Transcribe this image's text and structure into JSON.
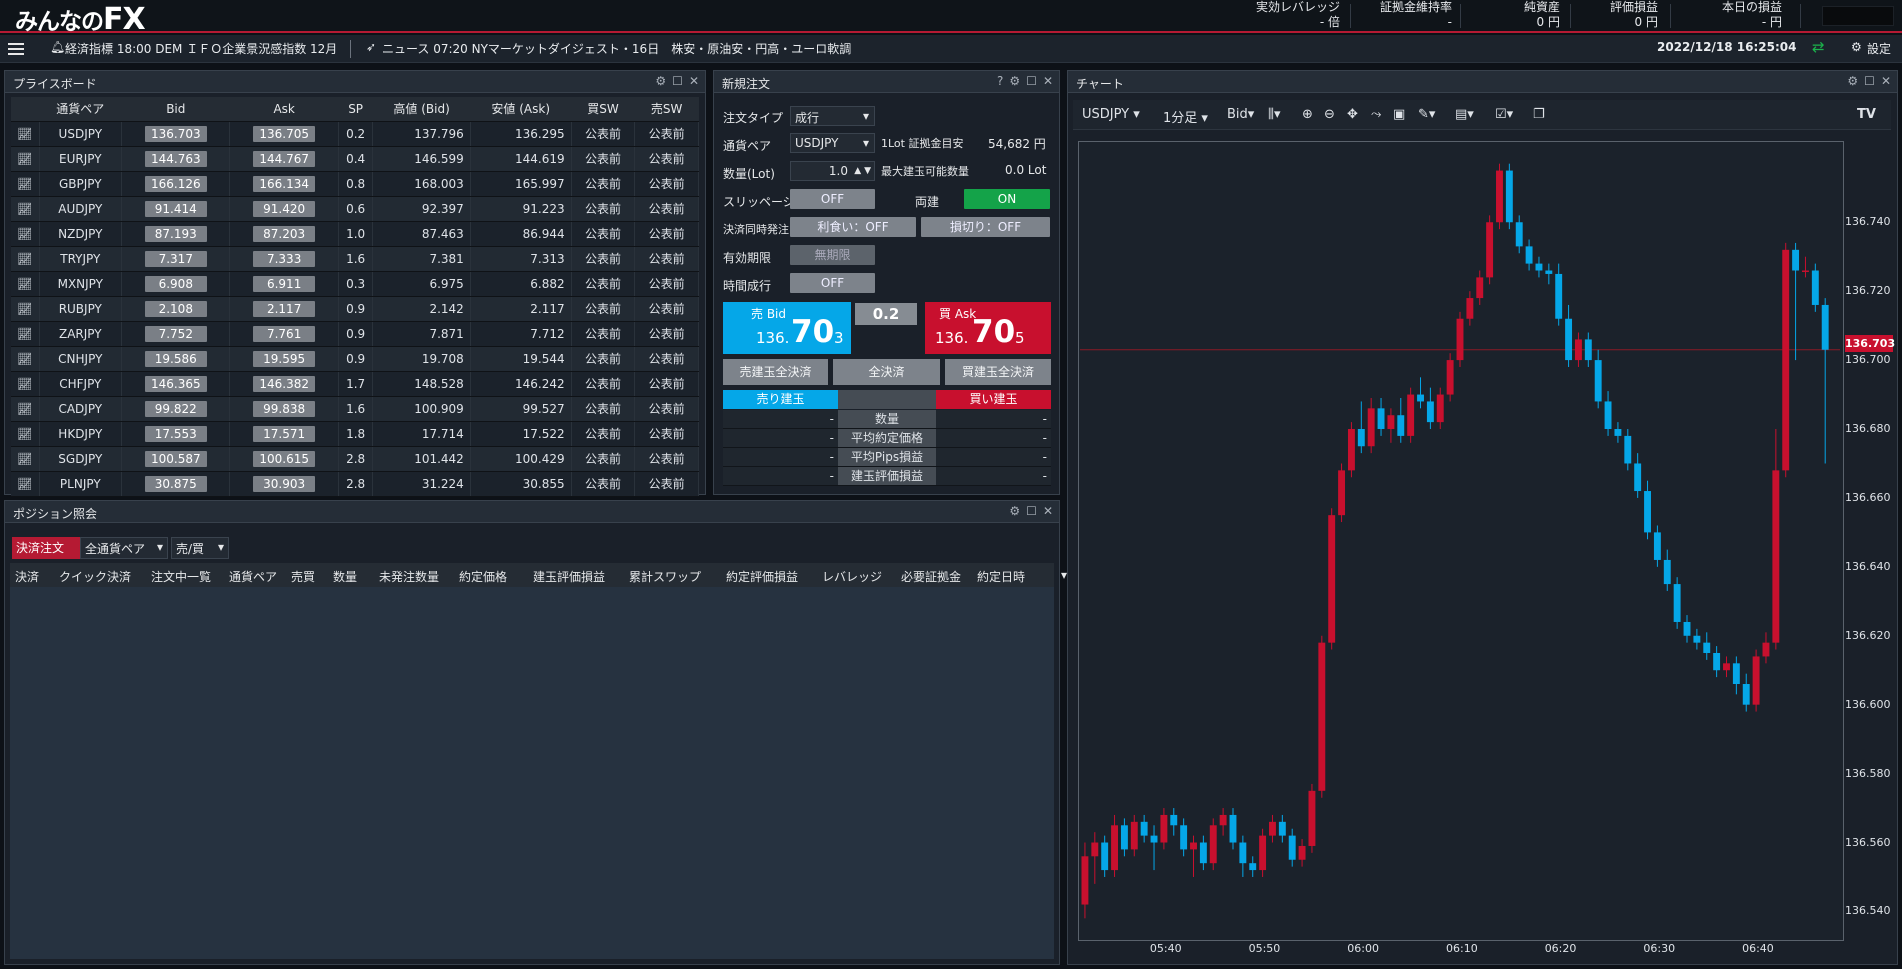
{
  "brand": {
    "logo_a": "みんなの",
    "logo_b": "FX"
  },
  "colors": {
    "bid": "#05a7e8",
    "ask": "#c8102e",
    "on": "#14a349",
    "up": "#c8102e",
    "down": "#05a7e8"
  },
  "header": {
    "stats": [
      {
        "label": "実効レバレッジ",
        "value": "- 倍"
      },
      {
        "label": "証拠金維持率",
        "value": "-"
      },
      {
        "label": "純資産",
        "value": "0 円"
      },
      {
        "label": "評価損益",
        "value": "0 円"
      },
      {
        "label": "本日の損益",
        "value": "- 円"
      }
    ]
  },
  "nav": {
    "econ": "経済指標 18:00 DEM ＩＦＯ企業景況感指数 12月",
    "news": "ニュース 07:20 NYマーケットダイジェスト・16日　株安・原油安・円高・ユーロ軟調",
    "datetime": "2022/12/18 16:25:04",
    "settings": "設定"
  },
  "priceboard": {
    "title": "プライスボード",
    "columns": [
      "通貨ペア",
      "Bid",
      "Ask",
      "SP",
      "高値 (Bid)",
      "安値 (Ask)",
      "買SW",
      "売SW"
    ],
    "rows": [
      [
        "USDJPY",
        "136.703",
        "136.705",
        "0.2",
        "137.796",
        "136.295",
        "公表前",
        "公表前"
      ],
      [
        "EURJPY",
        "144.763",
        "144.767",
        "0.4",
        "146.599",
        "144.619",
        "公表前",
        "公表前"
      ],
      [
        "GBPJPY",
        "166.126",
        "166.134",
        "0.8",
        "168.003",
        "165.997",
        "公表前",
        "公表前"
      ],
      [
        "AUDJPY",
        "91.414",
        "91.420",
        "0.6",
        "92.397",
        "91.223",
        "公表前",
        "公表前"
      ],
      [
        "NZDJPY",
        "87.193",
        "87.203",
        "1.0",
        "87.463",
        "86.944",
        "公表前",
        "公表前"
      ],
      [
        "TRYJPY",
        "7.317",
        "7.333",
        "1.6",
        "7.381",
        "7.313",
        "公表前",
        "公表前"
      ],
      [
        "MXNJPY",
        "6.908",
        "6.911",
        "0.3",
        "6.975",
        "6.882",
        "公表前",
        "公表前"
      ],
      [
        "RUBJPY",
        "2.108",
        "2.117",
        "0.9",
        "2.142",
        "2.117",
        "公表前",
        "公表前"
      ],
      [
        "ZARJPY",
        "7.752",
        "7.761",
        "0.9",
        "7.871",
        "7.712",
        "公表前",
        "公表前"
      ],
      [
        "CNHJPY",
        "19.586",
        "19.595",
        "0.9",
        "19.708",
        "19.544",
        "公表前",
        "公表前"
      ],
      [
        "CHFJPY",
        "146.365",
        "146.382",
        "1.7",
        "148.528",
        "146.242",
        "公表前",
        "公表前"
      ],
      [
        "CADJPY",
        "99.822",
        "99.838",
        "1.6",
        "100.909",
        "99.527",
        "公表前",
        "公表前"
      ],
      [
        "HKDJPY",
        "17.553",
        "17.571",
        "1.8",
        "17.714",
        "17.522",
        "公表前",
        "公表前"
      ],
      [
        "SGDJPY",
        "100.587",
        "100.615",
        "2.8",
        "101.442",
        "100.429",
        "公表前",
        "公表前"
      ],
      [
        "PLNJPY",
        "30.875",
        "30.903",
        "2.8",
        "31.224",
        "30.855",
        "公表前",
        "公表前"
      ]
    ]
  },
  "order": {
    "title": "新規注文",
    "order_type_label": "注文タイプ",
    "order_type": "成行",
    "pair_label": "通貨ペア",
    "pair": "USDJPY",
    "margin_label": "1Lot 証拠金目安",
    "margin": "54,682 円",
    "qty_label": "数量(Lot)",
    "qty": "1.0",
    "max_label": "最大建玉可能数量",
    "max": "0.0 Lot",
    "slip_label": "スリッページ",
    "slip": "OFF",
    "ryodate_label": "両建",
    "ryodate": "ON",
    "settle_label": "決済同時発注",
    "tp": "利食い：OFF",
    "sl": "損切り：OFF",
    "expiry_label": "有効期限",
    "expiry": "無期限",
    "timed_label": "時間成行",
    "timed": "OFF",
    "bid_label": "売 Bid",
    "bid_a": "136.",
    "bid_b": "70",
    "bid_c": "3",
    "ask_label": "買 Ask",
    "ask_a": "136.",
    "ask_b": "70",
    "ask_c": "5",
    "spread": "0.2",
    "close_sell": "売建玉全決済",
    "close_all": "全決済",
    "close_buy": "買建玉全決済",
    "sell_pos": "売り建玉",
    "buy_pos": "買い建玉",
    "grid": [
      {
        "l": "-",
        "c": "数量",
        "r": "-"
      },
      {
        "l": "-",
        "c": "平均約定価格",
        "r": "-"
      },
      {
        "l": "-",
        "c": "平均Pips損益",
        "r": "-"
      },
      {
        "l": "-",
        "c": "建玉評価損益",
        "r": "-"
      }
    ]
  },
  "positions": {
    "title": "ポジション照会",
    "btn_settle": "決済注文",
    "filter_pair": "全通貨ペア",
    "filter_side": "売/買",
    "columns": [
      "決済",
      "クイック決済",
      "注文中一覧",
      "通貨ペア",
      "売買",
      "数量",
      "未発注数量",
      "約定価格",
      "建玉評価損益",
      "累計スワップ",
      "約定評価損益",
      "レバレッジ",
      "必要証拠金",
      "約定日時"
    ]
  },
  "chart": {
    "title": "チャート",
    "pair": "USDJPY",
    "interval": "1分足",
    "side": "Bid",
    "current": "136.703",
    "y_ticks": [
      "136.740",
      "136.720",
      "136.700",
      "136.680",
      "136.660",
      "136.640",
      "136.620",
      "136.600",
      "136.580",
      "136.560",
      "136.540"
    ],
    "x_ticks": [
      "05:40",
      "05:50",
      "06:00",
      "06:10",
      "06:20",
      "06:30",
      "06:40"
    ]
  },
  "chart_data": {
    "type": "candlestick",
    "x": [
      "05:32",
      "05:33",
      "05:34",
      "05:35",
      "05:36",
      "05:37",
      "05:38",
      "05:39",
      "05:40",
      "05:41",
      "05:42",
      "05:43",
      "05:44",
      "05:45",
      "05:46",
      "05:47",
      "05:48",
      "05:49",
      "05:50",
      "05:51",
      "05:52",
      "05:53",
      "05:54",
      "05:55",
      "05:56",
      "05:57",
      "05:58",
      "05:59",
      "06:00",
      "06:01",
      "06:02",
      "06:03",
      "06:04",
      "06:05",
      "06:06",
      "06:07",
      "06:08",
      "06:09",
      "06:10",
      "06:11",
      "06:12",
      "06:13",
      "06:14",
      "06:15",
      "06:16",
      "06:17",
      "06:18",
      "06:19",
      "06:20",
      "06:21",
      "06:22",
      "06:23",
      "06:24",
      "06:25",
      "06:26",
      "06:27",
      "06:28",
      "06:29",
      "06:30",
      "06:31",
      "06:32",
      "06:33",
      "06:34",
      "06:35",
      "06:36",
      "06:37",
      "06:38",
      "06:39",
      "06:40",
      "06:41",
      "06:42",
      "06:43",
      "06:44",
      "06:45",
      "06:46",
      "06:47"
    ],
    "open": [
      136.542,
      136.556,
      136.56,
      136.552,
      136.565,
      136.558,
      136.566,
      136.562,
      136.56,
      136.568,
      136.565,
      136.558,
      136.56,
      136.554,
      136.565,
      136.568,
      136.56,
      136.554,
      136.552,
      136.562,
      136.566,
      136.562,
      136.555,
      136.559,
      136.575,
      136.618,
      136.655,
      136.668,
      136.68,
      136.675,
      136.686,
      136.68,
      136.684,
      136.678,
      136.69,
      136.688,
      136.682,
      136.69,
      136.7,
      136.712,
      136.718,
      136.724,
      136.74,
      136.755,
      136.74,
      136.733,
      136.728,
      136.726,
      136.725,
      136.712,
      136.7,
      136.706,
      136.7,
      136.688,
      136.68,
      136.678,
      136.67,
      136.662,
      136.65,
      136.642,
      136.635,
      136.624,
      136.62,
      136.618,
      136.615,
      136.61,
      136.612,
      136.606,
      136.6,
      136.614,
      136.618,
      136.668,
      136.732,
      136.726,
      136.726,
      136.716,
      136.712
    ],
    "close": [
      136.556,
      136.56,
      136.552,
      136.565,
      136.558,
      136.566,
      136.562,
      136.56,
      136.568,
      136.565,
      136.558,
      136.56,
      136.554,
      136.565,
      136.568,
      136.56,
      136.554,
      136.552,
      136.562,
      136.566,
      136.562,
      136.555,
      136.559,
      136.575,
      136.618,
      136.655,
      136.668,
      136.68,
      136.675,
      136.686,
      136.68,
      136.684,
      136.678,
      136.69,
      136.688,
      136.682,
      136.69,
      136.7,
      136.712,
      136.718,
      136.724,
      136.74,
      136.755,
      136.74,
      136.733,
      136.728,
      136.726,
      136.725,
      136.712,
      136.7,
      136.706,
      136.7,
      136.688,
      136.68,
      136.678,
      136.67,
      136.662,
      136.65,
      136.642,
      136.635,
      136.624,
      136.62,
      136.618,
      136.615,
      136.61,
      136.612,
      136.606,
      136.6,
      136.614,
      136.618,
      136.668,
      136.732,
      136.726,
      136.726,
      136.716,
      136.703
    ],
    "high": [
      136.56,
      136.563,
      136.562,
      136.568,
      136.567,
      136.568,
      136.568,
      136.565,
      136.57,
      136.57,
      136.567,
      136.562,
      136.562,
      136.567,
      136.57,
      136.57,
      136.562,
      136.556,
      136.564,
      136.568,
      136.568,
      136.564,
      136.561,
      136.577,
      136.62,
      136.657,
      136.67,
      136.682,
      136.688,
      136.689,
      136.689,
      136.686,
      136.689,
      136.692,
      136.695,
      136.692,
      136.692,
      136.702,
      136.714,
      136.72,
      136.726,
      136.742,
      136.757,
      136.757,
      136.742,
      136.735,
      136.73,
      136.728,
      136.728,
      136.716,
      136.708,
      136.708,
      136.703,
      136.691,
      136.682,
      136.68,
      136.673,
      136.665,
      136.652,
      136.645,
      136.637,
      136.626,
      136.622,
      136.621,
      136.617,
      136.614,
      136.614,
      136.609,
      136.616,
      136.621,
      136.68,
      136.734,
      136.734,
      136.73,
      136.728,
      136.718
    ],
    "low": [
      136.538,
      136.548,
      136.55,
      136.55,
      136.556,
      136.556,
      136.56,
      136.552,
      136.558,
      136.562,
      136.556,
      136.55,
      136.552,
      136.552,
      136.562,
      136.558,
      136.55,
      136.55,
      136.55,
      136.56,
      136.56,
      136.553,
      136.553,
      136.557,
      136.573,
      136.616,
      136.653,
      136.666,
      136.673,
      136.673,
      136.678,
      136.676,
      136.676,
      136.676,
      136.686,
      136.68,
      136.68,
      136.688,
      136.698,
      136.71,
      136.716,
      136.722,
      136.738,
      136.738,
      136.731,
      136.726,
      136.724,
      136.722,
      136.71,
      136.698,
      136.698,
      136.698,
      136.686,
      136.678,
      136.676,
      136.668,
      136.66,
      136.648,
      136.64,
      136.633,
      136.622,
      136.618,
      136.616,
      136.613,
      136.608,
      136.608,
      136.603,
      136.598,
      136.598,
      136.612,
      136.616,
      136.666,
      136.7,
      136.724,
      136.714,
      136.67
    ],
    "ylim": [
      136.532,
      136.763
    ]
  }
}
